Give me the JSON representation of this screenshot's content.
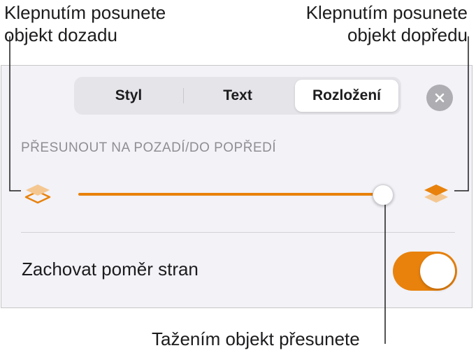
{
  "callouts": {
    "left": [
      "Klepnutím posunete",
      "objekt dozadu"
    ],
    "right": [
      "Klepnutím posunete",
      "objekt dopředu"
    ],
    "bottom": "Tažením objekt přesunete"
  },
  "segmented_control": {
    "tabs": [
      {
        "label": "Styl",
        "selected": false
      },
      {
        "label": "Text",
        "selected": false
      },
      {
        "label": "Rozložení",
        "selected": true
      }
    ]
  },
  "close_button": {
    "icon": "close-icon"
  },
  "arrange": {
    "section_title": "PŘESUNOUT NA POZADÍ/DO POPŘEDÍ",
    "back_icon": "layer-send-backward-icon",
    "front_icon": "layer-bring-forward-icon",
    "slider_fraction": 0.98
  },
  "aspect_ratio": {
    "label": "Zachovat poměr stran",
    "toggle_on": true
  },
  "colors": {
    "accent": "#e8820c",
    "accent_light": "#f5c790",
    "panel_bg": "#f2f2f7",
    "section_text": "#8e8e93"
  }
}
